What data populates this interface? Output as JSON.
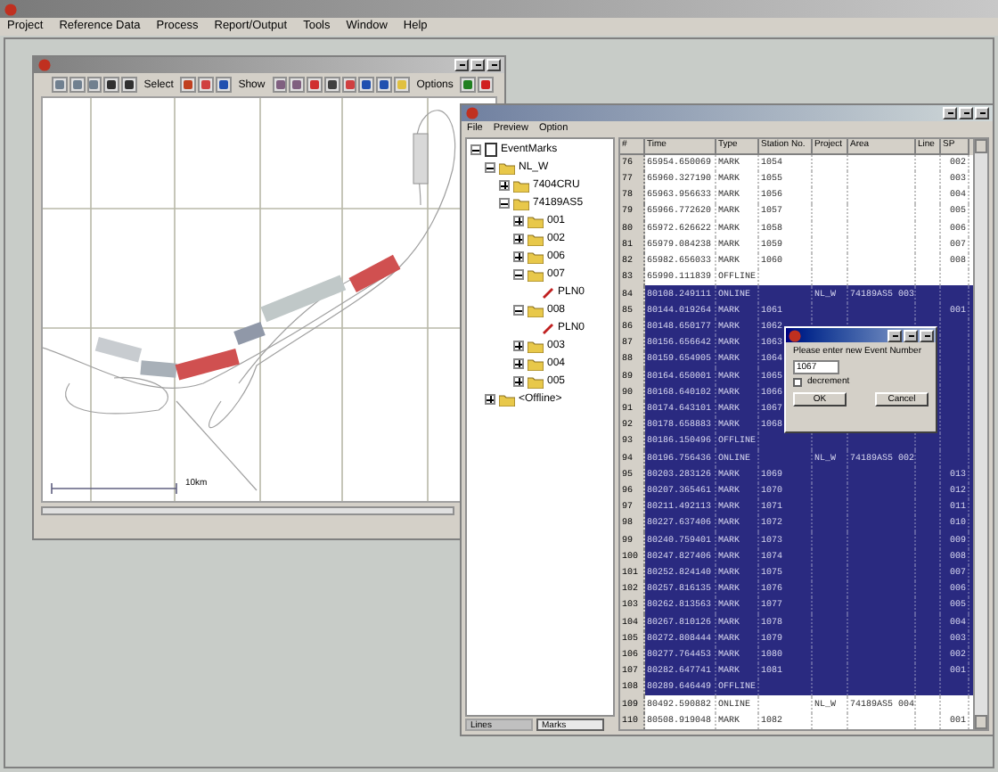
{
  "menu": [
    "Project",
    "Reference Data",
    "Process",
    "Report/Output",
    "Tools",
    "Window",
    "Help"
  ],
  "map_window": {
    "toolbar_labels": [
      "Select",
      "Show",
      "Options"
    ],
    "scale_label": "10km"
  },
  "events_window": {
    "menu": [
      "File",
      "Preview",
      "Option"
    ],
    "tree": [
      {
        "label": "EventMarks",
        "kind": "root",
        "expanded": true,
        "children": [
          {
            "label": "NL_W",
            "kind": "folder",
            "expanded": true,
            "children": [
              {
                "label": "7404CRU",
                "kind": "folder",
                "expanded": false
              },
              {
                "label": "74189AS5",
                "kind": "folder",
                "expanded": true,
                "children": [
                  {
                    "label": "001",
                    "kind": "folder",
                    "expanded": false
                  },
                  {
                    "label": "002",
                    "kind": "folder",
                    "expanded": false
                  },
                  {
                    "label": "006",
                    "kind": "folder",
                    "expanded": false
                  },
                  {
                    "label": "007",
                    "kind": "folder",
                    "expanded": true,
                    "children": [
                      {
                        "label": "PLN0",
                        "kind": "mark"
                      }
                    ]
                  },
                  {
                    "label": "008",
                    "kind": "folder",
                    "expanded": true,
                    "children": [
                      {
                        "label": "PLN0",
                        "kind": "mark"
                      }
                    ]
                  },
                  {
                    "label": "003",
                    "kind": "folder",
                    "expanded": false
                  },
                  {
                    "label": "004",
                    "kind": "folder",
                    "expanded": false
                  },
                  {
                    "label": "005",
                    "kind": "folder",
                    "expanded": false
                  }
                ]
              }
            ]
          },
          {
            "label": "<Offline>",
            "kind": "folder",
            "expanded": false
          }
        ]
      }
    ],
    "bottom_tabs": [
      {
        "label": "Lines",
        "selected": false
      },
      {
        "label": "Marks",
        "selected": true
      }
    ],
    "columns": [
      "#",
      "Time",
      "Type",
      "Station No.",
      "Project",
      "Area",
      "Line",
      "SP"
    ],
    "rows": [
      {
        "n": "76",
        "time": "65954.650069",
        "type": "MARK",
        "station": "1054",
        "sp": "002",
        "selected": false
      },
      {
        "n": "77",
        "time": "65960.327190",
        "type": "MARK",
        "station": "1055",
        "sp": "003",
        "selected": false
      },
      {
        "n": "78",
        "time": "65963.956633",
        "type": "MARK",
        "station": "1056",
        "sp": "004",
        "selected": false
      },
      {
        "n": "79",
        "time": "65966.772620",
        "type": "MARK",
        "station": "1057",
        "sp": "005",
        "selected": false
      },
      {
        "n": "80",
        "time": "65972.626622",
        "type": "MARK",
        "station": "1058",
        "sp": "006",
        "selected": false
      },
      {
        "n": "81",
        "time": "65979.084238",
        "type": "MARK",
        "station": "1059",
        "sp": "007",
        "selected": false
      },
      {
        "n": "82",
        "time": "65982.656033",
        "type": "MARK",
        "station": "1060",
        "sp": "008",
        "selected": false
      },
      {
        "n": "83",
        "time": "65990.111839",
        "type": "OFFLINE",
        "selected": false
      },
      {
        "n": "84",
        "time": "80108.249111",
        "type": "ONLINE",
        "project": "NL_W",
        "area": "74189AS5 003",
        "selected": true
      },
      {
        "n": "85",
        "time": "80144.019264",
        "type": "MARK",
        "station": "1061",
        "sp": "001",
        "selected": true
      },
      {
        "n": "86",
        "time": "80148.650177",
        "type": "MARK",
        "station": "1062",
        "selected": true
      },
      {
        "n": "87",
        "time": "80156.656642",
        "type": "MARK",
        "station": "1063",
        "selected": true
      },
      {
        "n": "88",
        "time": "80159.654905",
        "type": "MARK",
        "station": "1064",
        "selected": true
      },
      {
        "n": "89",
        "time": "80164.650001",
        "type": "MARK",
        "station": "1065",
        "selected": true
      },
      {
        "n": "90",
        "time": "80168.640102",
        "type": "MARK",
        "station": "1066",
        "selected": true
      },
      {
        "n": "91",
        "time": "80174.643101",
        "type": "MARK",
        "station": "1067",
        "selected": true
      },
      {
        "n": "92",
        "time": "80178.658883",
        "type": "MARK",
        "station": "1068",
        "selected": true
      },
      {
        "n": "93",
        "time": "80186.150496",
        "type": "OFFLINE",
        "selected": true
      },
      {
        "n": "94",
        "time": "80196.756436",
        "type": "ONLINE",
        "project": "NL_W",
        "area": "74189AS5 002",
        "selected": true
      },
      {
        "n": "95",
        "time": "80203.283126",
        "type": "MARK",
        "station": "1069",
        "sp": "013",
        "selected": true
      },
      {
        "n": "96",
        "time": "80207.365461",
        "type": "MARK",
        "station": "1070",
        "sp": "012",
        "selected": true
      },
      {
        "n": "97",
        "time": "80211.492113",
        "type": "MARK",
        "station": "1071",
        "sp": "011",
        "selected": true
      },
      {
        "n": "98",
        "time": "80227.637406",
        "type": "MARK",
        "station": "1072",
        "sp": "010",
        "selected": true
      },
      {
        "n": "99",
        "time": "80240.759401",
        "type": "MARK",
        "station": "1073",
        "sp": "009",
        "selected": true
      },
      {
        "n": "100",
        "time": "80247.827406",
        "type": "MARK",
        "station": "1074",
        "sp": "008",
        "selected": true
      },
      {
        "n": "101",
        "time": "80252.824140",
        "type": "MARK",
        "station": "1075",
        "sp": "007",
        "selected": true
      },
      {
        "n": "102",
        "time": "80257.816135",
        "type": "MARK",
        "station": "1076",
        "sp": "006",
        "selected": true
      },
      {
        "n": "103",
        "time": "80262.813563",
        "type": "MARK",
        "station": "1077",
        "sp": "005",
        "selected": true
      },
      {
        "n": "104",
        "time": "80267.810126",
        "type": "MARK",
        "station": "1078",
        "sp": "004",
        "selected": true
      },
      {
        "n": "105",
        "time": "80272.808444",
        "type": "MARK",
        "station": "1079",
        "sp": "003",
        "selected": true
      },
      {
        "n": "106",
        "time": "80277.764453",
        "type": "MARK",
        "station": "1080",
        "sp": "002",
        "selected": true
      },
      {
        "n": "107",
        "time": "80282.647741",
        "type": "MARK",
        "station": "1081",
        "sp": "001",
        "selected": true
      },
      {
        "n": "108",
        "time": "80289.646449",
        "type": "OFFLINE",
        "selected": true
      },
      {
        "n": "109",
        "time": "80492.590882",
        "type": "ONLINE",
        "project": "NL_W",
        "area": "74189AS5 004",
        "selected": false
      },
      {
        "n": "110",
        "time": "80508.919048",
        "type": "MARK",
        "station": "1082",
        "sp": "001",
        "selected": false
      }
    ]
  },
  "dialog": {
    "prompt": "Please enter new Event Number",
    "value": "1067",
    "checkbox": {
      "label": "decrement",
      "checked": false
    },
    "buttons": [
      "OK",
      "Cancel"
    ]
  }
}
